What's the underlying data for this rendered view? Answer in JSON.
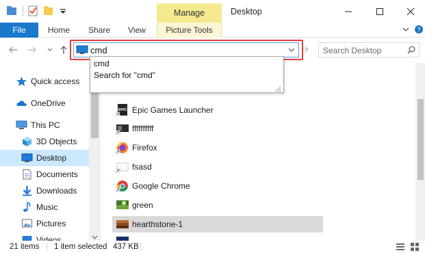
{
  "window": {
    "title": "Desktop",
    "contextual_tab_group": "Manage"
  },
  "ribbon": {
    "tabs": [
      "File",
      "Home",
      "Share",
      "View",
      "Picture Tools"
    ]
  },
  "address": {
    "value": "cmd"
  },
  "search": {
    "placeholder": "Search Desktop"
  },
  "autocomplete": {
    "items": [
      "cmd",
      "Search for \"cmd\""
    ]
  },
  "nav": {
    "items": [
      {
        "label": "Quick access",
        "icon": "star-icon"
      },
      {
        "label": "OneDrive",
        "icon": "cloud-icon"
      },
      {
        "label": "This PC",
        "icon": "computer-icon"
      },
      {
        "label": "3D Objects",
        "icon": "cube-icon"
      },
      {
        "label": "Desktop",
        "icon": "desktop-icon",
        "selected": true
      },
      {
        "label": "Documents",
        "icon": "document-icon"
      },
      {
        "label": "Downloads",
        "icon": "download-icon"
      },
      {
        "label": "Music",
        "icon": "music-icon"
      },
      {
        "label": "Pictures",
        "icon": "picture-icon"
      },
      {
        "label": "Videos",
        "icon": "video-icon"
      }
    ]
  },
  "files": {
    "items": [
      {
        "label": "Epic Games Launcher",
        "icon": "epic-games-icon"
      },
      {
        "label": "ffffffffff",
        "icon": "image-thumb-icon"
      },
      {
        "label": "Firefox",
        "icon": "firefox-icon"
      },
      {
        "label": "fsasd",
        "icon": "blank-file-icon"
      },
      {
        "label": "Google Chrome",
        "icon": "chrome-icon"
      },
      {
        "label": "green",
        "icon": "image-thumb-icon"
      },
      {
        "label": "hearthstone-1",
        "icon": "image-thumb-icon",
        "selected": true
      }
    ]
  },
  "status": {
    "count": "21 items",
    "selected": "1 item selected",
    "size": "437 KB"
  },
  "colors": {
    "accent": "#1979ca",
    "manage": "#f5ea8f",
    "highlight": "#e23b3b",
    "selection": "#cce8ff"
  }
}
